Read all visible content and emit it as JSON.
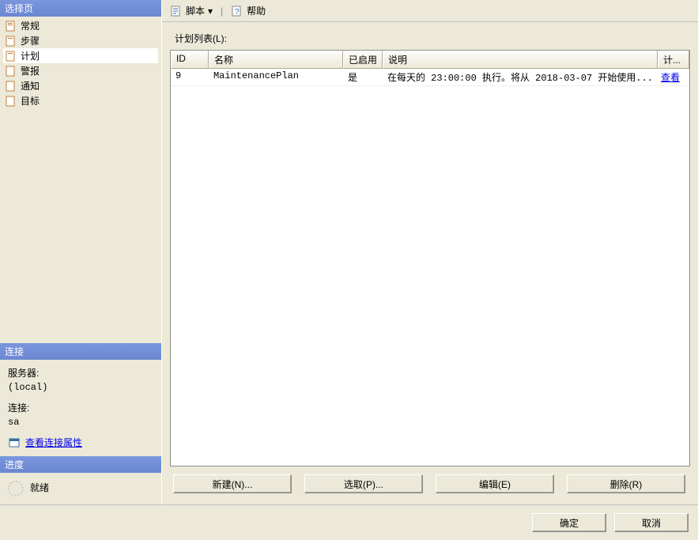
{
  "left": {
    "select_header": "选择页",
    "nav": {
      "general": "常规",
      "steps": "步骤",
      "schedules": "计划",
      "alerts": "警报",
      "notify": "通知",
      "targets": "目标"
    },
    "conn_header": "连接",
    "server_label": "服务器:",
    "server_value": "(local)",
    "conn_label": "连接:",
    "conn_value": "sa",
    "view_conn_link": "查看连接属性",
    "progress_header": "进度",
    "ready": "就绪"
  },
  "toolbar": {
    "script": "脚本",
    "help": "帮助"
  },
  "content": {
    "list_label": "计划列表(L):",
    "headers": {
      "id": "ID",
      "name": "名称",
      "enabled": "已启用",
      "desc": "说明",
      "plan": "计..."
    },
    "rows": [
      {
        "id": "9",
        "name": "MaintenancePlan",
        "enabled": "是",
        "desc": "在每天的 23:00:00 执行。将从 2018-03-07 开始使用...",
        "link": "查看"
      }
    ],
    "buttons": {
      "new": "新建(N)...",
      "pick": "选取(P)...",
      "edit": "编辑(E)",
      "remove": "删除(R)"
    }
  },
  "footer": {
    "ok": "确定",
    "cancel": "取消"
  }
}
